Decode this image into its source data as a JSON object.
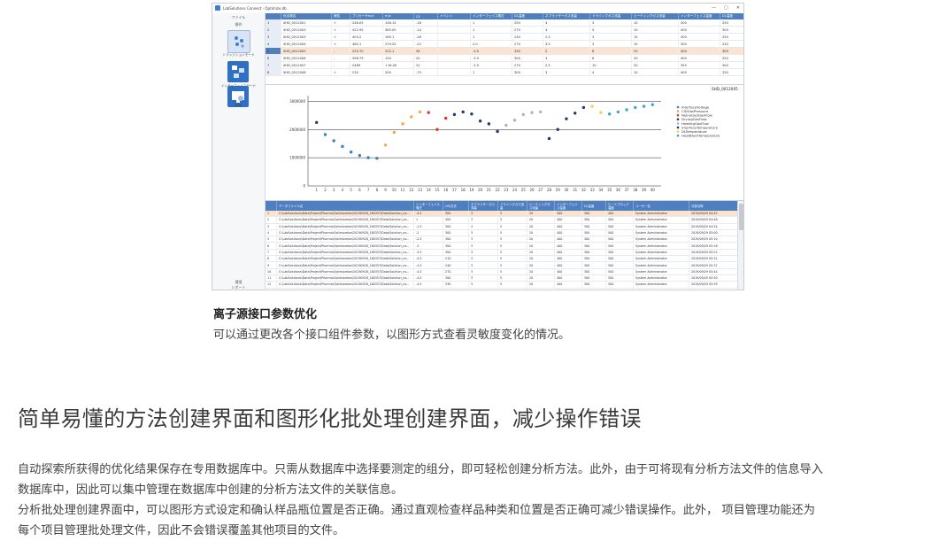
{
  "app": {
    "window_title": "LabSolutions Connect - Optimize.db",
    "window_controls": [
      "—",
      "▢",
      "✕"
    ]
  },
  "sidebar": {
    "top_items": [
      "ファイル",
      "操作"
    ],
    "nav": [
      {
        "label": "トランジションモード",
        "icon": "transition-mode-icon"
      },
      {
        "label": "インターフェイスモード",
        "icon": "interface-mode-icon"
      },
      {
        "label": "設定",
        "icon": "settings-monitor-icon"
      }
    ],
    "bottom_items": [
      "環境",
      "レポート"
    ]
  },
  "top_table": {
    "columns": [
      "",
      "化合物名",
      "極性",
      "プリカーサm/z",
      "ｍ/z",
      "CE",
      "イベント",
      "インターフェイス電圧",
      "DL温度",
      "ネブライザーガス流量",
      "ドライングガス流量",
      "ヒーティングガス流量",
      "インターフェイス温度",
      "DL温度",
      "ヒートブロック温度"
    ],
    "rows": [
      [
        "1",
        "SHD_0012001",
        "+",
        "248.05",
        "146.15",
        "-16",
        "",
        "1",
        "250",
        "3",
        "3",
        "10",
        "300",
        "250",
        "400"
      ],
      [
        "2",
        "SHD_0012003",
        "+",
        "422.95",
        "385.05",
        "-14",
        "",
        "1",
        "270",
        "3",
        "5",
        "10",
        "400",
        "300",
        "400"
      ],
      [
        "3",
        "SHD_0012003",
        "+",
        "403.2",
        "165.1",
        "-28",
        "",
        "1",
        "230",
        "2.5",
        "3",
        "15",
        "300",
        "250",
        "400"
      ],
      [
        "4",
        "SHD_0012004",
        "+",
        "460.1",
        "279.25",
        "-22",
        "",
        "2.0",
        "270",
        "3.5",
        "3",
        "15",
        "300",
        "220",
        "300"
      ],
      [
        "5",
        "SHD_0012005",
        "-",
        "225.70",
        "222.1",
        "34",
        "",
        "-3.5",
        "330",
        "2",
        "6",
        "20",
        "400",
        "300",
        "400"
      ],
      [
        "6",
        "SHD_0012006",
        "-",
        "396.75",
        "150",
        "20",
        "",
        "-3.5",
        "300",
        "3",
        "6",
        "20",
        "400",
        "250",
        "400"
      ],
      [
        "7",
        "SHD_0012007",
        "-",
        "2469",
        "+16.00",
        "22",
        "",
        "-3.5",
        "270",
        "2.5",
        "10",
        "20",
        "350",
        "300",
        "300"
      ],
      [
        "8",
        "SHD_0012008",
        "+",
        "230",
        "200",
        "-75",
        "",
        "1",
        "300",
        "3",
        "4",
        "10",
        "400",
        "250",
        "400"
      ]
    ],
    "selected_row": 4
  },
  "selected_compound": "SHD_0012005",
  "chart_data": {
    "type": "scatter",
    "x": [
      1,
      2,
      3,
      4,
      5,
      6,
      7,
      8,
      9,
      10,
      11,
      12,
      13,
      14,
      15,
      16,
      17,
      18,
      19,
      20,
      21,
      22,
      23,
      24,
      25,
      26,
      27,
      28,
      29,
      30,
      31,
      32,
      33,
      34,
      35,
      36,
      37,
      38,
      39,
      40
    ],
    "y": [
      2250000,
      1820000,
      1600000,
      1400000,
      1200000,
      1080000,
      1000000,
      980000,
      1450000,
      1900000,
      2200000,
      2450000,
      2620000,
      2600000,
      2000000,
      2400000,
      2530000,
      2620000,
      2550000,
      2300000,
      2200000,
      1930000,
      2150000,
      2330000,
      2530000,
      2600000,
      2620000,
      1680000,
      2000000,
      2380000,
      2580000,
      2780000,
      2820000,
      2600000,
      2550000,
      2620000,
      2700000,
      2780000,
      2820000,
      2880000
    ],
    "colors": [
      "#1f3b6e",
      "#3c7fc4",
      "#3c7fc4",
      "#3c7fc4",
      "#3c7fc4",
      "#3c7fc4",
      "#3c7fc4",
      "#3c7fc4",
      "#f5a546",
      "#f5a546",
      "#f5a546",
      "#f5a546",
      "#f5a546",
      "#d93a2e",
      "#d93a2e",
      "#d93a2e",
      "#1f3b6e",
      "#1f3b6e",
      "#1f3b6e",
      "#1f3b6e",
      "#1f3b6e",
      "#1f3b6e",
      "#b3b3b3",
      "#b3b3b3",
      "#b3b3b3",
      "#b3b3b3",
      "#b3b3b3",
      "#1f3b6e",
      "#1f3b6e",
      "#1f3b6e",
      "#1f3b6e",
      "#1f3b6e",
      "#f5d24a",
      "#f5d24a",
      "#3aa6c9",
      "#3aa6c9",
      "#3aa6c9",
      "#3aa6c9",
      "#3aa6c9",
      "#3aa6c9"
    ],
    "yticks": [
      0,
      1000000,
      2000000,
      3000000
    ],
    "ytick_labels": [
      "0",
      "1000000",
      "2000000",
      "3000000"
    ],
    "ylim": [
      0,
      3200000
    ],
    "xlim": [
      0,
      41
    ],
    "grid": true,
    "legend_position": "right",
    "legend": [
      {
        "name": "InterfaceVoltage",
        "color": "#3c7fc4"
      },
      {
        "name": "CIDGasPressure",
        "color": "#f5a546"
      },
      {
        "name": "NebulizedGasFlow",
        "color": "#d93a2e"
      },
      {
        "name": "DryingGasFlow",
        "color": "#1f3b6e"
      },
      {
        "name": "HeatingGasFlow",
        "color": "#b3b3b3"
      },
      {
        "name": "InterfaceTemperature",
        "color": "#1f3b6e"
      },
      {
        "name": "DLTemperature",
        "color": "#f5d24a"
      },
      {
        "name": "HeatBlockTemperature",
        "color": "#3aa6c9"
      }
    ]
  },
  "bottom_table": {
    "columns": [
      "",
      "データファイル名",
      "インターフェイス電圧",
      "CID方式",
      "ネブライザーガス流量",
      "ドライングガス流量",
      "ヒーティングガス流量",
      "インターフェイス温度",
      "DL温度",
      "ヒートブロック温度",
      "ユーザー名",
      "分析日時"
    ],
    "rows": [
      [
        "1",
        "C:\\LabSolutions\\Data\\Project\\Pharma\\Optimization\\20190928_180357\\Data\\Solution_no...",
        "-4.5",
        "300",
        "3",
        "3",
        "20",
        "400",
        "300",
        "400",
        "System Administrator",
        "2019/09/29 04:42"
      ],
      [
        "2",
        "C:\\LabSolutions\\Data\\Project\\Pharma\\Optimization\\20190928_180357\\Data\\Solution_no...",
        "1",
        "300",
        "3",
        "5",
        "20",
        "400",
        "300",
        "500",
        "System Administrator",
        "2019/09/29 04:48"
      ],
      [
        "3",
        "C:\\LabSolutions\\Data\\Project\\Pharma\\Optimization\\20190928_180357\\Data\\Solution_no...",
        "-1.5",
        "300",
        "3",
        "5",
        "20",
        "400",
        "300",
        "500",
        "System Administrator",
        "2019/09/29 04:54"
      ],
      [
        "4",
        "C:\\LabSolutions\\Data\\Project\\Pharma\\Optimization\\20190928_180357\\Data\\Solution_no...",
        "-2",
        "300",
        "3",
        "5",
        "20",
        "400",
        "300",
        "500",
        "System Administrator",
        "2019/09/29 05:00"
      ],
      [
        "5",
        "C:\\LabSolutions\\Data\\Project\\Pharma\\Optimization\\20190928_180357\\Data\\Solution_no...",
        "-2.5",
        "300",
        "3",
        "5",
        "20",
        "400",
        "300",
        "500",
        "System Administrator",
        "2019/09/29 05:10"
      ],
      [
        "6",
        "C:\\LabSolutions\\Data\\Project\\Pharma\\Optimization\\20190928_180357\\Data\\Solution_no...",
        "-3",
        "300",
        "3",
        "5",
        "20",
        "400",
        "300",
        "500",
        "System Administrator",
        "2019/09/29 05:16"
      ],
      [
        "7",
        "C:\\LabSolutions\\Data\\Project\\Pharma\\Optimization\\20190928_180357\\Data\\Solution_no...",
        "-3.5",
        "300",
        "3",
        "5",
        "20",
        "400",
        "300",
        "500",
        "System Administrator",
        "2019/09/29 05:22"
      ],
      [
        "8",
        "C:\\LabSolutions\\Data\\Project\\Pharma\\Optimization\\20190928_180357\\Data\\Solution_no...",
        "-4.5",
        "210",
        "3",
        "5",
        "20",
        "400",
        "300",
        "500",
        "System Administrator",
        "2019/09/29 05:31"
      ],
      [
        "9",
        "C:\\LabSolutions\\Data\\Project\\Pharma\\Optimization\\20190928_180357\\Data\\Solution_no...",
        "-4.5",
        "240",
        "3",
        "5",
        "20",
        "400",
        "300",
        "500",
        "System Administrator",
        "2019/09/29 05:37"
      ],
      [
        "10",
        "C:\\LabSolutions\\Data\\Project\\Pharma\\Optimization\\20190928_180357\\Data\\Solution_no...",
        "-4.5",
        "270",
        "3",
        "5",
        "20",
        "400",
        "300",
        "500",
        "System Administrator",
        "2019/09/29 05:44"
      ],
      [
        "11",
        "C:\\LabSolutions\\Data\\Project\\Pharma\\Optimization\\20190928_180357\\Data\\Solution_no...",
        "-4.5",
        "300",
        "3",
        "5",
        "20",
        "400",
        "300",
        "500",
        "System Administrator",
        "2019/09/29 05:50"
      ],
      [
        "12",
        "C:\\LabSolutions\\Data\\Project\\Pharma\\Optimization\\20190928_180357\\Data\\Solution_no...",
        "-4.5",
        "330",
        "3",
        "5",
        "20",
        "400",
        "300",
        "500",
        "System Administrator",
        "2019/09/29 05:59"
      ]
    ],
    "selected_row": 0
  },
  "caption": {
    "title": "离子源接口参数优化",
    "text": "可以通过更改各个接口组件参数，以图形方式查看灵敏度变化的情况。"
  },
  "section": {
    "heading": "简单易懂的方法创建界面和图形化批处理创建界面，减少操作错误",
    "paragraphs": [
      "自动探索所获得的优化结果保存在专用数据库中。只需从数据库中选择要测定的组分，即可轻松创建分析方法。此外，由于可将现有分析方法文件的信息导入",
      "数据库中，因此可以集中管理在数据库中创建的分析方法文件的关联信息。",
      "分析批处理创建界面中，可以图形方式设定和确认样品瓶位置是否正确。通过直观检查样品种类和位置是否正确可减少错误操作。此外， 项目管理功能还为",
      "每个项目管理批处理文件，因此不会错误覆盖其他项目的文件。"
    ]
  }
}
